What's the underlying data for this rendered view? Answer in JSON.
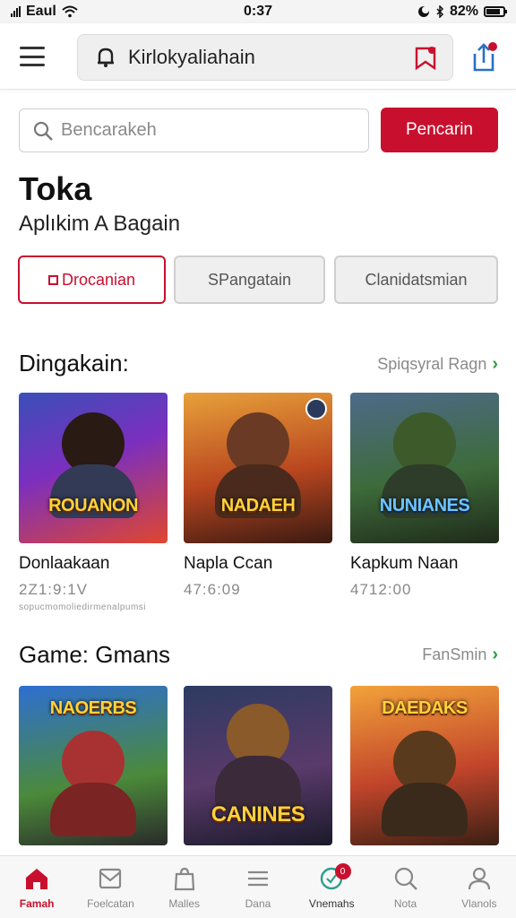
{
  "status_bar": {
    "carrier": "Eaul",
    "time": "0:37",
    "battery": "82%",
    "battery_level": 0.82
  },
  "header": {
    "title": "Kirlokyaliahain"
  },
  "search": {
    "placeholder": "Bencarakeh",
    "button_label": "Pencarin"
  },
  "page": {
    "title": "Toka",
    "subtitle": "Aplıkim A Bagain"
  },
  "filters": [
    {
      "label": "Drocanian"
    },
    {
      "label": "SPangatain"
    },
    {
      "label": "Clanidatsmian"
    }
  ],
  "sections": [
    {
      "title": "Dingakain:",
      "link": "Spiqsyral Ragn",
      "note": "sopucmomoliedirmenalpumsi",
      "items": [
        {
          "name": "Donlaakaan",
          "meta": "2Z1:9:1V",
          "logo": "ROUANON",
          "icon": "game-artwork-hero"
        },
        {
          "name": "Napla Ccan",
          "meta": "47:6:09",
          "logo": "NADAEH",
          "icon": "game-artwork-warrior"
        },
        {
          "name": "Kapkum Naan",
          "meta": "4712:00",
          "logo": "NUNIANES",
          "icon": "game-artwork-knight"
        }
      ]
    },
    {
      "title": "Game: Gmans",
      "link": "FanSmin",
      "items": [
        {
          "name": "",
          "logo": "NAOERBS",
          "icon": "game-artwork-fighter"
        },
        {
          "name": "",
          "logo": "CANINES",
          "icon": "game-artwork-mage"
        },
        {
          "name": "",
          "logo": "DAEDAKS",
          "icon": "game-artwork-ranger"
        }
      ]
    }
  ],
  "bottom_nav": [
    {
      "label": "Famah",
      "icon": "home-icon",
      "active": true
    },
    {
      "label": "Foelcatan",
      "icon": "mail-icon"
    },
    {
      "label": "Malles",
      "icon": "bag-icon"
    },
    {
      "label": "Dana",
      "icon": "menu-icon"
    },
    {
      "label": "Vnemahs",
      "icon": "chat-icon",
      "badge": "0"
    },
    {
      "label": "Nota",
      "icon": "search-icon"
    },
    {
      "label": "Vlanols",
      "icon": "profile-icon"
    }
  ],
  "colors": {
    "accent": "#c8102e",
    "link_chevron": "#2e9e3e",
    "background": "#ffffff"
  }
}
